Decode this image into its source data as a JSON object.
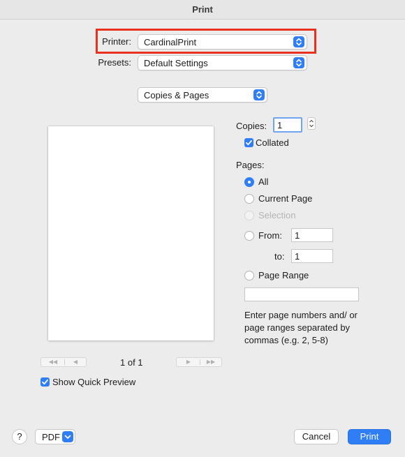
{
  "window": {
    "title": "Print"
  },
  "printer": {
    "label": "Printer:",
    "value": "CardinalPrint"
  },
  "presets": {
    "label": "Presets:",
    "value": "Default Settings"
  },
  "section": {
    "value": "Copies & Pages"
  },
  "preview": {
    "page_indicator": "1 of 1",
    "show_quick_preview_label": "Show Quick Preview",
    "show_quick_preview_checked": true
  },
  "copies": {
    "label": "Copies:",
    "value": "1"
  },
  "collated": {
    "label": "Collated",
    "checked": true
  },
  "pages": {
    "label": "Pages:",
    "selected": "All",
    "options": {
      "all": "All",
      "current": "Current Page",
      "selection": "Selection",
      "from": "From:",
      "to": "to:",
      "range": "Page Range"
    },
    "from_value": "1",
    "to_value": "1",
    "range_value": "",
    "hint": "Enter page numbers and/ or page ranges separated by commas (e.g. 2, 5-8)"
  },
  "footer": {
    "help": "?",
    "pdf": "PDF",
    "cancel": "Cancel",
    "print": "Print"
  },
  "colors": {
    "accent": "#2f7ef6",
    "highlight": "#e8311f"
  }
}
